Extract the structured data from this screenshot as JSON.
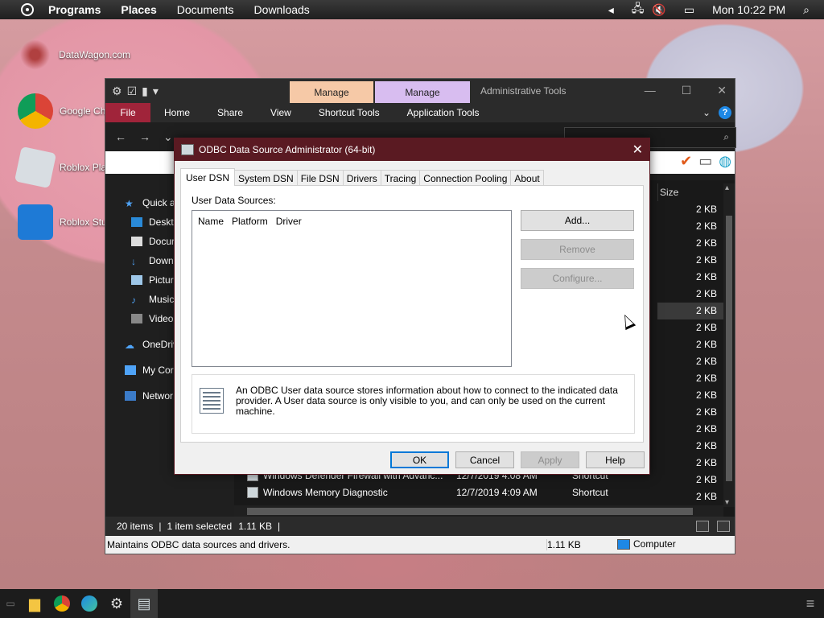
{
  "topbar": {
    "menus": [
      "Programs",
      "Places",
      "Documents",
      "Downloads"
    ],
    "clock": "Mon 10:22 PM"
  },
  "desktop_icons": [
    {
      "label": "DataWagon.com"
    },
    {
      "label": "Google Ch"
    },
    {
      "label": "Roblox Pla"
    },
    {
      "label": "Roblox Stu"
    }
  ],
  "explorer": {
    "title": "Administrative Tools",
    "context_tabs": [
      "Manage",
      "Manage"
    ],
    "ribbon_tabs": [
      "File",
      "Home",
      "Share",
      "View",
      "Shortcut Tools",
      "Application Tools"
    ],
    "nav_items": [
      "Quick a",
      "Deskto",
      "Docur",
      "Down",
      "Pictur",
      "Music",
      "Videos",
      "OneDriv",
      "My Cor",
      "Networ"
    ],
    "size_header": "Size",
    "sizes": [
      "2 KB",
      "2 KB",
      "2 KB",
      "2 KB",
      "2 KB",
      "2 KB",
      "2 KB",
      "2 KB",
      "2 KB",
      "2 KB",
      "2 KB",
      "2 KB",
      "2 KB",
      "2 KB",
      "2 KB",
      "2 KB",
      "2 KB",
      "2 KB"
    ],
    "files": [
      {
        "name": "Windows Defender Firewall with Advanc...",
        "date": "12/7/2019 4:08 AM",
        "type": "Shortcut"
      },
      {
        "name": "Windows Memory Diagnostic",
        "date": "12/7/2019 4:09 AM",
        "type": "Shortcut"
      }
    ],
    "status": {
      "items": "20 items",
      "selected": "1 item selected",
      "size": "1.11 KB"
    },
    "infobar": {
      "description": "Maintains ODBC data sources and drivers.",
      "size": "1.11 KB",
      "location": "Computer"
    }
  },
  "dialog": {
    "title": "ODBC Data Source Administrator (64-bit)",
    "tabs": [
      "User DSN",
      "System DSN",
      "File DSN",
      "Drivers",
      "Tracing",
      "Connection Pooling",
      "About"
    ],
    "active_tab": "User DSN",
    "list_label": "User Data Sources:",
    "columns": [
      "Name",
      "Platform",
      "Driver"
    ],
    "buttons": {
      "add": "Add...",
      "remove": "Remove",
      "configure": "Configure..."
    },
    "info_text": "An ODBC User data source stores information about how to connect to the indicated data provider.  A User data source is only visible to you, and can only be used on the current machine.",
    "footer": {
      "ok": "OK",
      "cancel": "Cancel",
      "apply": "Apply",
      "help": "Help"
    }
  },
  "colors": {
    "dialog_title_bg": "#5a1a22",
    "ribbon_file": "#a0243a",
    "manage_shortcut": "#f6c9a7",
    "manage_application": "#d8bdf0",
    "default_button_border": "#0078d7"
  }
}
